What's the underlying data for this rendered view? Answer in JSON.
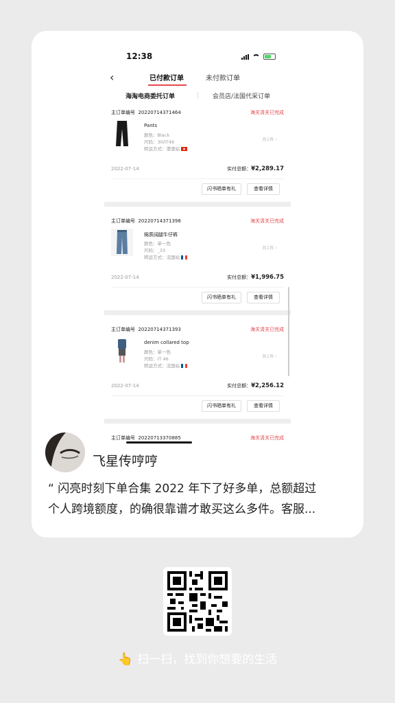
{
  "screenshot": {
    "status": {
      "time": "12:38"
    },
    "tabs": [
      {
        "label": "已付款订单"
      },
      {
        "label": "未付款订单"
      }
    ],
    "subtabs": [
      {
        "label": "海淘电商委托订单"
      },
      {
        "label": "会员店/法国代采订单"
      }
    ],
    "orders": [
      {
        "number_label": "主订单编号",
        "number": "20220714371464",
        "status": "海关清关已完成",
        "product": "Pants",
        "color": "颜色：Black",
        "size": "尺码：30/IT46",
        "shipping": "转运方式：港澳站",
        "qty": "共1件",
        "date": "2022-07-14",
        "total_label": "实付总额：",
        "total": "¥2,289.17",
        "btn_share": "闪书晒单有礼",
        "btn_detail": "查看详情"
      },
      {
        "number_label": "主订单编号",
        "number": "20220714371398",
        "status": "海关清关已完成",
        "product": "棉质阔腿牛仔裤",
        "color": "颜色：单一色",
        "size": "尺码：_33",
        "shipping": "转运方式：法国站",
        "qty": "共1件",
        "date": "2022-07-14",
        "total_label": "实付总额：",
        "total": "¥1,996.75",
        "btn_share": "闪书晒单有礼",
        "btn_detail": "查看详情"
      },
      {
        "number_label": "主订单编号",
        "number": "20220714371393",
        "status": "海关清关已完成",
        "product": "denim collared top",
        "color": "颜色：单一色",
        "size": "尺码：IT 46",
        "shipping": "转运方式：法国站",
        "qty": "共1件",
        "date": "2022-07-14",
        "total_label": "实付总额：",
        "total": "¥2,256.12",
        "btn_share": "闪书晒单有礼",
        "btn_detail": "查看详情"
      }
    ],
    "last_order": {
      "number_label": "主订单编号",
      "number": "20220713370885",
      "status": "海关清关已完成"
    }
  },
  "post": {
    "username": "飞星传哼哼",
    "quote_line1": "“ 闪亮时刻下单合集 2022 年下了好多单，总额超过",
    "quote_line2": "个人跨境额度，的确很靠谱才敢买这么多件。客服..."
  },
  "footer": {
    "scan_text": "扫一扫，找到你想要的生活",
    "hand_icon": "👆"
  },
  "colors": {
    "accent": "#e5484d",
    "background": "#ebebeb"
  }
}
